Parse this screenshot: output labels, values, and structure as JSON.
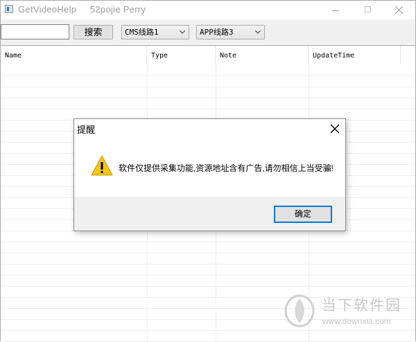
{
  "window": {
    "title": "GetVideoHelp     52pojie Perry"
  },
  "toolbar": {
    "search_value": "",
    "search_button_label": "搜索",
    "cms_line_selected": "CMS线路1",
    "app_line_selected": "APP线路3"
  },
  "grid": {
    "columns": [
      "Name",
      "Type",
      "Note",
      "UpdateTime"
    ],
    "rows": []
  },
  "dialog": {
    "title": "提醒",
    "message": "软件仅提供采集功能,资源地址含有广告,请勿相信上当受骗!",
    "ok_label": "确定",
    "icon": "warning-icon"
  },
  "watermark": {
    "name": "当下软件园",
    "url": "www.downxia.com"
  },
  "colors": {
    "accent": "#0078d7",
    "warning": "#f5c518",
    "watermark": "#c8c8c8"
  }
}
